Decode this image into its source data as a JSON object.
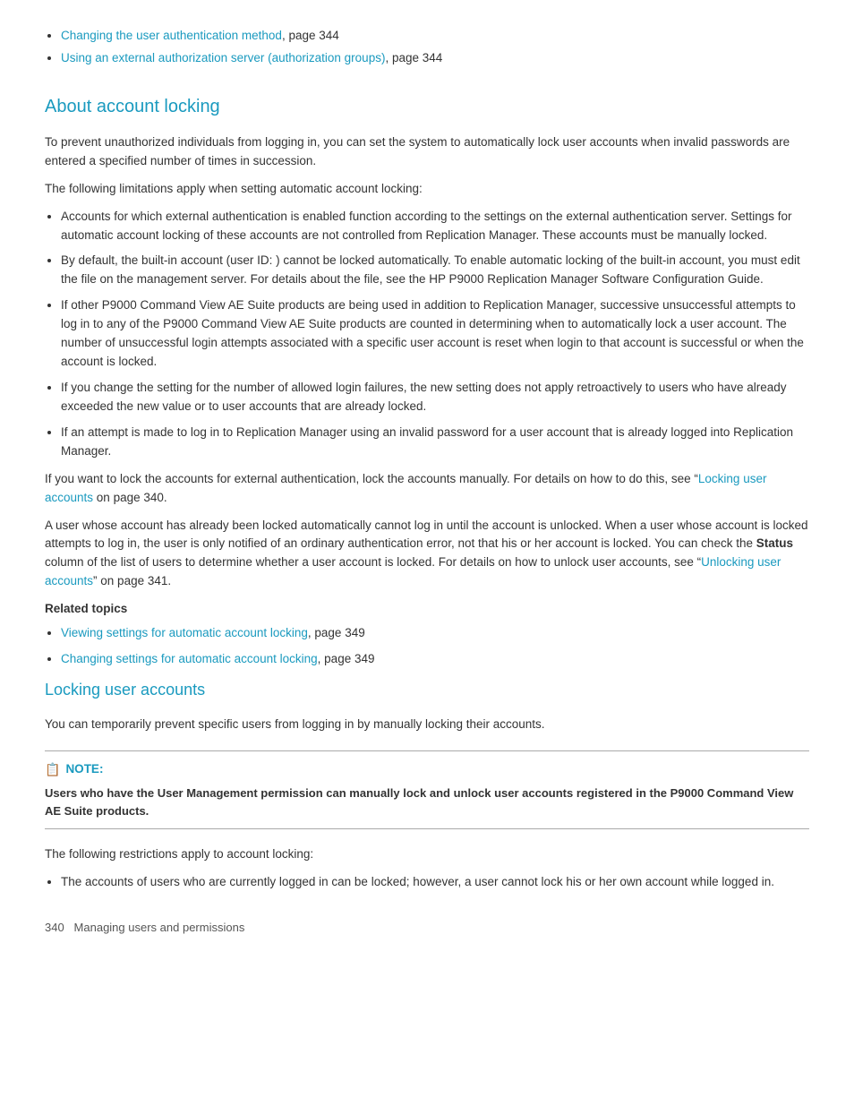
{
  "top_links": [
    {
      "link_text": "Changing the user authentication method",
      "suffix": ", page 344"
    },
    {
      "link_text": "Using an external authorization server (authorization groups)",
      "suffix": ", page 344"
    }
  ],
  "about_section": {
    "title": "About account locking",
    "paragraphs": [
      "To prevent unauthorized individuals from logging in, you can set the system to automatically lock user accounts when invalid passwords are entered a specified number of times in succession.",
      "The following limitations apply when setting automatic account locking:"
    ],
    "bullets": [
      "Accounts for which external authentication is enabled function according to the settings on the external authentication server. Settings for automatic account locking of these accounts are not controlled from Replication Manager. These accounts must be manually locked.",
      "By default, the built-in account (user ID:        ) cannot be locked automatically. To enable automatic locking of the built-in account, you must edit the               file on the management server. For details about the                    file, see the HP P9000 Replication Manager Software Configuration Guide.",
      "If other P9000 Command View AE Suite products are being used in addition to Replication Manager, successive unsuccessful attempts to log in to any of the P9000 Command View AE Suite products are counted in determining when to automatically lock a user account. The number of unsuccessful login attempts associated with a specific user account is reset when login to that account is successful or when the account is locked.",
      "If you change the setting for the number of allowed login failures, the new setting does not apply retroactively to users who have already exceeded the new value or to user accounts that are already locked.",
      "If an attempt is made to log in to Replication Manager using an invalid password for a user account that is already logged into Replication Manager."
    ],
    "after_bullets_1": "If you want to lock the accounts for external authentication, lock the accounts manually. For details on how to do this, see “Locking user accounts” on page 340.",
    "locking_link": "Locking user accounts",
    "locking_page": " on page 340.",
    "after_bullets_2_start": "A user whose account has already been locked automatically cannot log in until the account is unlocked. When a user whose account is locked attempts to log in, the user is only notified of an ordinary authentication error, not that his or her account is locked.  You can check the ",
    "status_bold": "Status",
    "after_bullets_2_end": " column of the list of users to determine whether a user account is locked. For details on how to unlock user accounts, see “",
    "unlocking_link": "Unlocking user accounts",
    "unlocking_suffix": "” on page 341.",
    "related_topics_label": "Related topics",
    "related_bullets": [
      {
        "link_text": "Viewing settings for automatic account locking",
        "suffix": ", page 349"
      },
      {
        "link_text": "Changing settings for automatic account locking",
        "suffix": ", page 349"
      }
    ]
  },
  "locking_section": {
    "title": "Locking user accounts",
    "intro": "You can temporarily prevent specific users from logging in by manually locking their accounts.",
    "note_label": "NOTE:",
    "note_content": "Users who have the User Management permission can manually lock and unlock user accounts registered in the P9000 Command View AE Suite products.",
    "after_note": "The following restrictions apply to account locking:",
    "restrictions": [
      "The accounts of users who are currently logged in can be locked; however, a user cannot lock his or her own account while logged in."
    ]
  },
  "footer": {
    "page_number": "340",
    "text": "Managing users and permissions"
  }
}
